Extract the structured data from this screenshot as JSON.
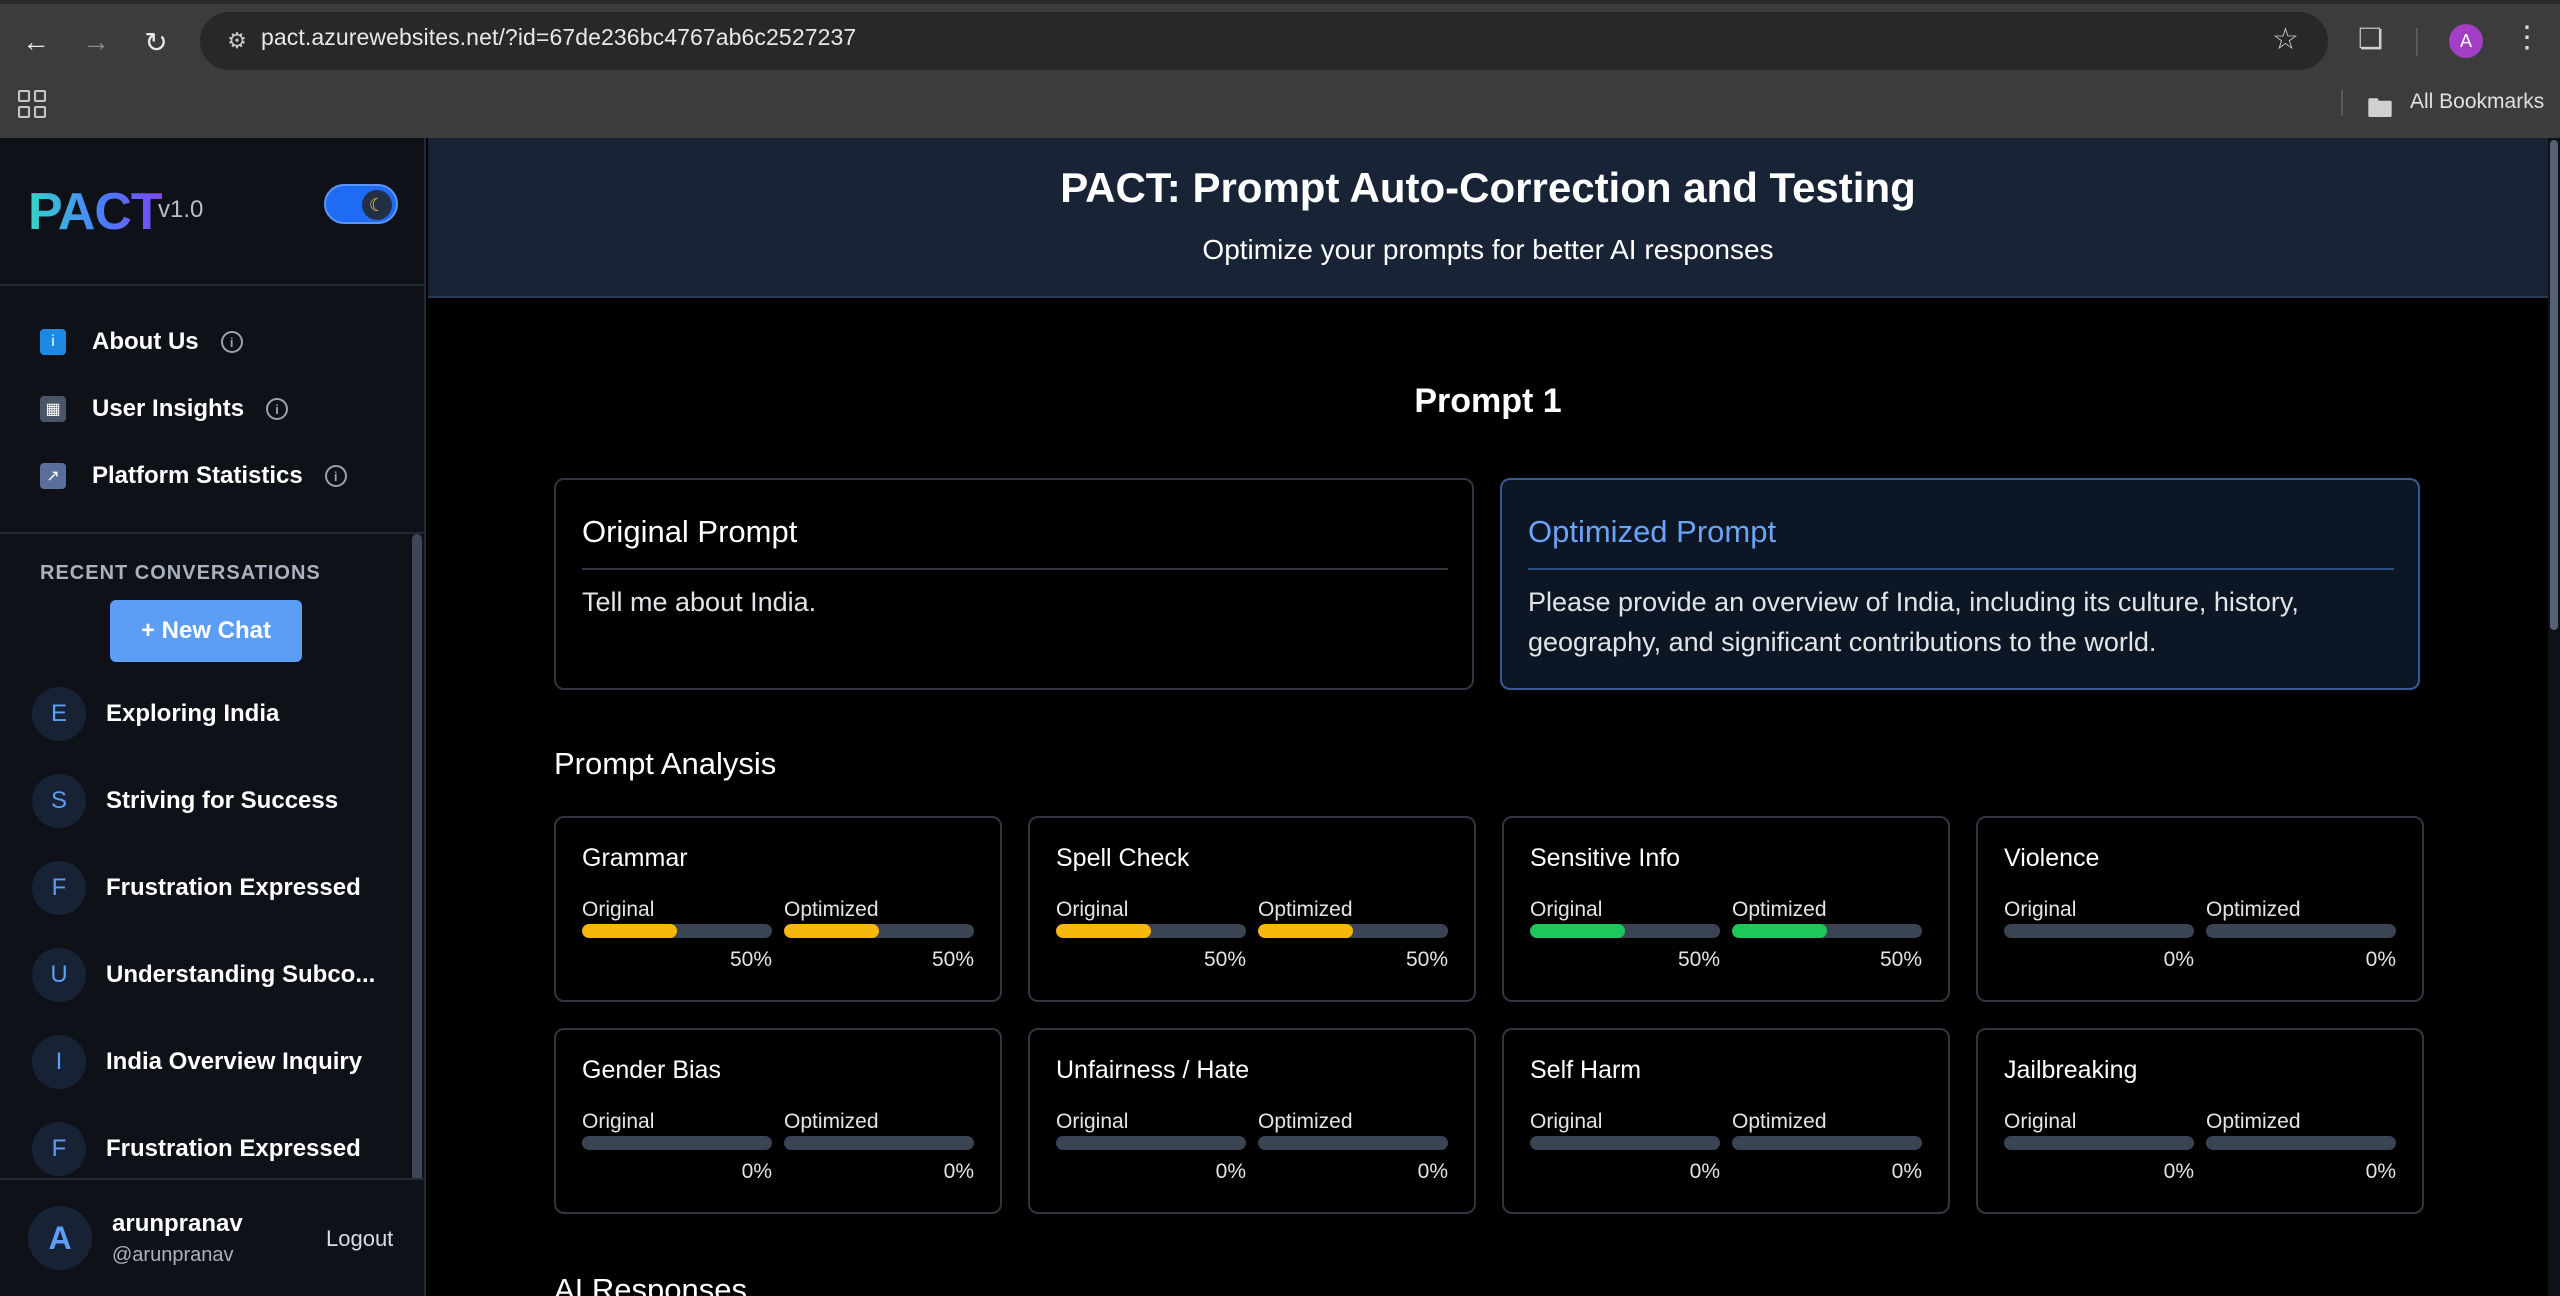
{
  "browser": {
    "url": "pact.azurewebsites.net/?id=67de236bc4767ab6c2527237",
    "profile_initial": "A",
    "bookmarks_label": "All Bookmarks"
  },
  "sidebar": {
    "logo": "PACT",
    "version": "v1.0",
    "nav": [
      {
        "label": "About Us"
      },
      {
        "label": "User Insights"
      },
      {
        "label": "Platform Statistics"
      }
    ],
    "recent_title": "RECENT CONVERSATIONS",
    "new_chat_label": "+ New Chat",
    "conversations": [
      {
        "initial": "E",
        "label": "Exploring India"
      },
      {
        "initial": "S",
        "label": "Striving for Success"
      },
      {
        "initial": "F",
        "label": "Frustration Expressed"
      },
      {
        "initial": "U",
        "label": "Understanding Subco..."
      },
      {
        "initial": "I",
        "label": "India Overview Inquiry"
      },
      {
        "initial": "F",
        "label": "Frustration Expressed"
      }
    ],
    "user": {
      "initial": "A",
      "name": "arunpranav",
      "handle": "@arunpranav",
      "logout": "Logout"
    }
  },
  "header": {
    "title": "PACT: Prompt Auto-Correction and Testing",
    "subtitle": "Optimize your prompts for better AI responses"
  },
  "prompt": {
    "heading": "Prompt 1",
    "original_title": "Original Prompt",
    "original_text": "Tell me about India.",
    "optimized_title": "Optimized Prompt",
    "optimized_text": "Please provide an overview of India, including its culture, history, geography, and significant contributions to the world."
  },
  "analysis": {
    "title": "Prompt Analysis",
    "original_label": "Original",
    "optimized_label": "Optimized",
    "metrics": [
      {
        "name": "Grammar",
        "original": 50,
        "optimized": 50,
        "original_text": "50%",
        "optimized_text": "50%",
        "color": "#f5b80b"
      },
      {
        "name": "Spell Check",
        "original": 50,
        "optimized": 50,
        "original_text": "50%",
        "optimized_text": "50%",
        "color": "#f5b80b"
      },
      {
        "name": "Sensitive Info",
        "original": 50,
        "optimized": 50,
        "original_text": "50%",
        "optimized_text": "50%",
        "color": "#1fc75a"
      },
      {
        "name": "Violence",
        "original": 0,
        "optimized": 0,
        "original_text": "0%",
        "optimized_text": "0%",
        "color": "#1fc75a"
      },
      {
        "name": "Gender Bias",
        "original": 0,
        "optimized": 0,
        "original_text": "0%",
        "optimized_text": "0%",
        "color": "#1fc75a"
      },
      {
        "name": "Unfairness / Hate",
        "original": 0,
        "optimized": 0,
        "original_text": "0%",
        "optimized_text": "0%",
        "color": "#1fc75a"
      },
      {
        "name": "Self Harm",
        "original": 0,
        "optimized": 0,
        "original_text": "0%",
        "optimized_text": "0%",
        "color": "#1fc75a"
      },
      {
        "name": "Jailbreaking",
        "original": 0,
        "optimized": 0,
        "original_text": "0%",
        "optimized_text": "0%",
        "color": "#1fc75a"
      }
    ]
  },
  "ai_responses_title": "AI Responses"
}
